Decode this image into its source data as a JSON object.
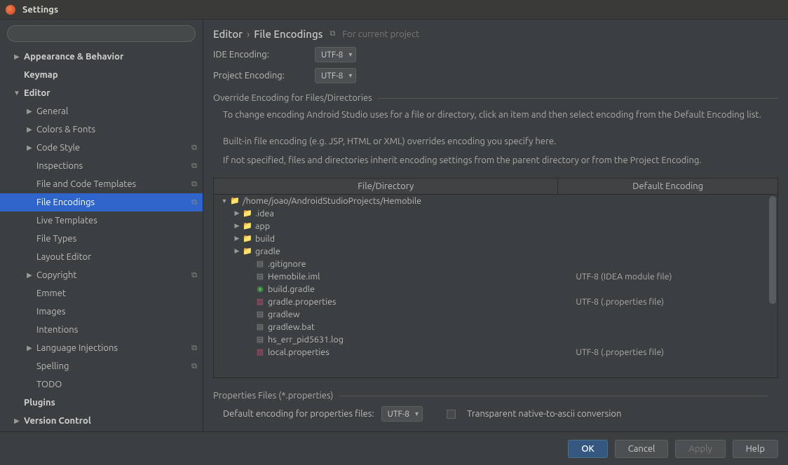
{
  "window": {
    "title": "Settings"
  },
  "search": {
    "placeholder": ""
  },
  "sidebar": [
    {
      "label": "Appearance & Behavior",
      "depth": 0,
      "disc": "▶",
      "bold": true
    },
    {
      "label": "Keymap",
      "depth": 0,
      "disc": "",
      "bold": true
    },
    {
      "label": "Editor",
      "depth": 0,
      "disc": "▼",
      "bold": true
    },
    {
      "label": "General",
      "depth": 1,
      "disc": "▶"
    },
    {
      "label": "Colors & Fonts",
      "depth": 1,
      "disc": "▶"
    },
    {
      "label": "Code Style",
      "depth": 1,
      "disc": "▶",
      "trail": "⧉"
    },
    {
      "label": "Inspections",
      "depth": 1,
      "disc": "",
      "trail": "⧉"
    },
    {
      "label": "File and Code Templates",
      "depth": 1,
      "disc": "",
      "trail": "⧉"
    },
    {
      "label": "File Encodings",
      "depth": 1,
      "disc": "",
      "trail": "⧉",
      "selected": true
    },
    {
      "label": "Live Templates",
      "depth": 1,
      "disc": ""
    },
    {
      "label": "File Types",
      "depth": 1,
      "disc": ""
    },
    {
      "label": "Layout Editor",
      "depth": 1,
      "disc": ""
    },
    {
      "label": "Copyright",
      "depth": 1,
      "disc": "▶",
      "trail": "⧉"
    },
    {
      "label": "Emmet",
      "depth": 1,
      "disc": ""
    },
    {
      "label": "Images",
      "depth": 1,
      "disc": ""
    },
    {
      "label": "Intentions",
      "depth": 1,
      "disc": ""
    },
    {
      "label": "Language Injections",
      "depth": 1,
      "disc": "▶",
      "trail": "⧉"
    },
    {
      "label": "Spelling",
      "depth": 1,
      "disc": "",
      "trail": "⧉"
    },
    {
      "label": "TODO",
      "depth": 1,
      "disc": ""
    },
    {
      "label": "Plugins",
      "depth": 0,
      "disc": "",
      "bold": true
    },
    {
      "label": "Version Control",
      "depth": 0,
      "disc": "▶",
      "bold": true
    }
  ],
  "breadcrumb": {
    "a": "Editor",
    "b": "File Encodings",
    "hint": "For current project",
    "badge": "⧉"
  },
  "form": {
    "ide_label": "IDE Encoding:",
    "ide_value": "UTF-8",
    "proj_label": "Project Encoding:",
    "proj_value": "UTF-8"
  },
  "override": {
    "title": "Override Encoding for Files/Directories",
    "help1": "To change encoding Android Studio uses for a file or directory, click an item and then select encoding from the Default Encoding list.",
    "help2": "Built-in file encoding (e.g. JSP, HTML or XML) overrides encoding you specify here.",
    "help3": "If not specified, files and directories inherit encoding settings from the parent directory or from the Project Encoding."
  },
  "table": {
    "col_file": "File/Directory",
    "col_enc": "Default Encoding",
    "rows": [
      {
        "depth": 0,
        "disc": "▼",
        "icon": "folder",
        "name": "/home/joao/AndroidStudioProjects/Hemobile",
        "enc": ""
      },
      {
        "depth": 1,
        "disc": "▶",
        "icon": "folder",
        "name": ".idea",
        "enc": ""
      },
      {
        "depth": 1,
        "disc": "▶",
        "icon": "folder",
        "name": "app",
        "enc": ""
      },
      {
        "depth": 1,
        "disc": "▶",
        "icon": "folder",
        "name": "build",
        "enc": ""
      },
      {
        "depth": 1,
        "disc": "▶",
        "icon": "folder",
        "name": "gradle",
        "enc": ""
      },
      {
        "depth": 2,
        "disc": "",
        "icon": "file",
        "name": ".gitignore",
        "enc": ""
      },
      {
        "depth": 2,
        "disc": "",
        "icon": "file",
        "name": "Hemobile.iml",
        "enc": "UTF-8 (IDEA module file)"
      },
      {
        "depth": 2,
        "disc": "",
        "icon": "green",
        "name": "build.gradle",
        "enc": ""
      },
      {
        "depth": 2,
        "disc": "",
        "icon": "props",
        "name": "gradle.properties",
        "enc": "UTF-8 (.properties file)"
      },
      {
        "depth": 2,
        "disc": "",
        "icon": "file",
        "name": "gradlew",
        "enc": ""
      },
      {
        "depth": 2,
        "disc": "",
        "icon": "file",
        "name": "gradlew.bat",
        "enc": ""
      },
      {
        "depth": 2,
        "disc": "",
        "icon": "file",
        "name": "hs_err_pid5631.log",
        "enc": ""
      },
      {
        "depth": 2,
        "disc": "",
        "icon": "props",
        "name": "local.properties",
        "enc": "UTF-8 (.properties file)"
      }
    ]
  },
  "props": {
    "title": "Properties Files (*.properties)",
    "label": "Default encoding for properties files:",
    "value": "UTF-8",
    "checkbox": "Transparent native-to-ascii conversion"
  },
  "buttons": {
    "ok": "OK",
    "cancel": "Cancel",
    "apply": "Apply",
    "help": "Help"
  }
}
